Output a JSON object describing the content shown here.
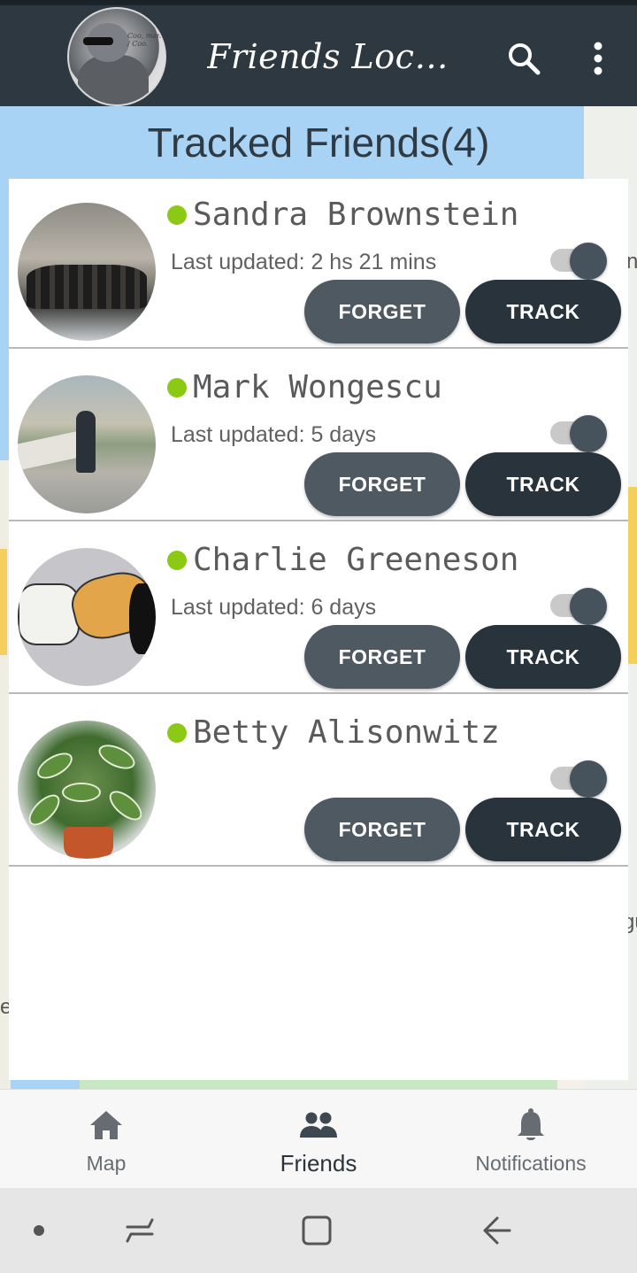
{
  "app": {
    "title": "Friends Locati...",
    "avatar_scribble_line1": "Coo, man",
    "avatar_scribble_line2": "/ Coo."
  },
  "list": {
    "title": "Tracked Friends(4)"
  },
  "friends": [
    {
      "name": "Sandra Brownstein",
      "last_updated": "Last updated: 2 hs 21 mins",
      "online": true,
      "toggle_on": true,
      "forget_label": "FORGET",
      "track_label": "TRACK"
    },
    {
      "name": "Mark Wongescu",
      "last_updated": "Last updated: 5 days",
      "online": true,
      "toggle_on": true,
      "forget_label": "FORGET",
      "track_label": "TRACK"
    },
    {
      "name": "Charlie Greeneson",
      "last_updated": "Last updated: 6 days",
      "online": true,
      "toggle_on": true,
      "forget_label": "FORGET",
      "track_label": "TRACK"
    },
    {
      "name": "Betty Alisonwitz",
      "last_updated": "",
      "online": true,
      "toggle_on": true,
      "forget_label": "FORGET",
      "track_label": "TRACK"
    }
  ],
  "bottom_nav": {
    "items": [
      {
        "label": "Map",
        "icon": "home-icon",
        "active": false
      },
      {
        "label": "Friends",
        "icon": "people-icon",
        "active": true
      },
      {
        "label": "Notifications",
        "icon": "bell-icon",
        "active": false
      }
    ]
  },
  "map_edge_letters": [
    "n",
    "e",
    "gu"
  ],
  "colors": {
    "app_bar": "#2d3840",
    "online": "#8cc914",
    "forget_button": "#4e5961",
    "track_button": "#28333b",
    "map_water": "#a9d3f5"
  }
}
